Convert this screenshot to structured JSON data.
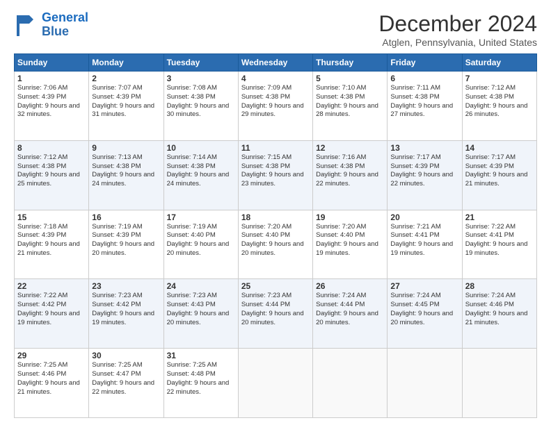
{
  "logo": {
    "line1": "General",
    "line2": "Blue"
  },
  "title": "December 2024",
  "location": "Atglen, Pennsylvania, United States",
  "days_of_week": [
    "Sunday",
    "Monday",
    "Tuesday",
    "Wednesday",
    "Thursday",
    "Friday",
    "Saturday"
  ],
  "weeks": [
    [
      {
        "day": "1",
        "sunrise": "Sunrise: 7:06 AM",
        "sunset": "Sunset: 4:39 PM",
        "daylight": "Daylight: 9 hours and 32 minutes."
      },
      {
        "day": "2",
        "sunrise": "Sunrise: 7:07 AM",
        "sunset": "Sunset: 4:39 PM",
        "daylight": "Daylight: 9 hours and 31 minutes."
      },
      {
        "day": "3",
        "sunrise": "Sunrise: 7:08 AM",
        "sunset": "Sunset: 4:38 PM",
        "daylight": "Daylight: 9 hours and 30 minutes."
      },
      {
        "day": "4",
        "sunrise": "Sunrise: 7:09 AM",
        "sunset": "Sunset: 4:38 PM",
        "daylight": "Daylight: 9 hours and 29 minutes."
      },
      {
        "day": "5",
        "sunrise": "Sunrise: 7:10 AM",
        "sunset": "Sunset: 4:38 PM",
        "daylight": "Daylight: 9 hours and 28 minutes."
      },
      {
        "day": "6",
        "sunrise": "Sunrise: 7:11 AM",
        "sunset": "Sunset: 4:38 PM",
        "daylight": "Daylight: 9 hours and 27 minutes."
      },
      {
        "day": "7",
        "sunrise": "Sunrise: 7:12 AM",
        "sunset": "Sunset: 4:38 PM",
        "daylight": "Daylight: 9 hours and 26 minutes."
      }
    ],
    [
      {
        "day": "8",
        "sunrise": "Sunrise: 7:12 AM",
        "sunset": "Sunset: 4:38 PM",
        "daylight": "Daylight: 9 hours and 25 minutes."
      },
      {
        "day": "9",
        "sunrise": "Sunrise: 7:13 AM",
        "sunset": "Sunset: 4:38 PM",
        "daylight": "Daylight: 9 hours and 24 minutes."
      },
      {
        "day": "10",
        "sunrise": "Sunrise: 7:14 AM",
        "sunset": "Sunset: 4:38 PM",
        "daylight": "Daylight: 9 hours and 24 minutes."
      },
      {
        "day": "11",
        "sunrise": "Sunrise: 7:15 AM",
        "sunset": "Sunset: 4:38 PM",
        "daylight": "Daylight: 9 hours and 23 minutes."
      },
      {
        "day": "12",
        "sunrise": "Sunrise: 7:16 AM",
        "sunset": "Sunset: 4:38 PM",
        "daylight": "Daylight: 9 hours and 22 minutes."
      },
      {
        "day": "13",
        "sunrise": "Sunrise: 7:17 AM",
        "sunset": "Sunset: 4:39 PM",
        "daylight": "Daylight: 9 hours and 22 minutes."
      },
      {
        "day": "14",
        "sunrise": "Sunrise: 7:17 AM",
        "sunset": "Sunset: 4:39 PM",
        "daylight": "Daylight: 9 hours and 21 minutes."
      }
    ],
    [
      {
        "day": "15",
        "sunrise": "Sunrise: 7:18 AM",
        "sunset": "Sunset: 4:39 PM",
        "daylight": "Daylight: 9 hours and 21 minutes."
      },
      {
        "day": "16",
        "sunrise": "Sunrise: 7:19 AM",
        "sunset": "Sunset: 4:39 PM",
        "daylight": "Daylight: 9 hours and 20 minutes."
      },
      {
        "day": "17",
        "sunrise": "Sunrise: 7:19 AM",
        "sunset": "Sunset: 4:40 PM",
        "daylight": "Daylight: 9 hours and 20 minutes."
      },
      {
        "day": "18",
        "sunrise": "Sunrise: 7:20 AM",
        "sunset": "Sunset: 4:40 PM",
        "daylight": "Daylight: 9 hours and 20 minutes."
      },
      {
        "day": "19",
        "sunrise": "Sunrise: 7:20 AM",
        "sunset": "Sunset: 4:40 PM",
        "daylight": "Daylight: 9 hours and 19 minutes."
      },
      {
        "day": "20",
        "sunrise": "Sunrise: 7:21 AM",
        "sunset": "Sunset: 4:41 PM",
        "daylight": "Daylight: 9 hours and 19 minutes."
      },
      {
        "day": "21",
        "sunrise": "Sunrise: 7:22 AM",
        "sunset": "Sunset: 4:41 PM",
        "daylight": "Daylight: 9 hours and 19 minutes."
      }
    ],
    [
      {
        "day": "22",
        "sunrise": "Sunrise: 7:22 AM",
        "sunset": "Sunset: 4:42 PM",
        "daylight": "Daylight: 9 hours and 19 minutes."
      },
      {
        "day": "23",
        "sunrise": "Sunrise: 7:23 AM",
        "sunset": "Sunset: 4:42 PM",
        "daylight": "Daylight: 9 hours and 19 minutes."
      },
      {
        "day": "24",
        "sunrise": "Sunrise: 7:23 AM",
        "sunset": "Sunset: 4:43 PM",
        "daylight": "Daylight: 9 hours and 20 minutes."
      },
      {
        "day": "25",
        "sunrise": "Sunrise: 7:23 AM",
        "sunset": "Sunset: 4:44 PM",
        "daylight": "Daylight: 9 hours and 20 minutes."
      },
      {
        "day": "26",
        "sunrise": "Sunrise: 7:24 AM",
        "sunset": "Sunset: 4:44 PM",
        "daylight": "Daylight: 9 hours and 20 minutes."
      },
      {
        "day": "27",
        "sunrise": "Sunrise: 7:24 AM",
        "sunset": "Sunset: 4:45 PM",
        "daylight": "Daylight: 9 hours and 20 minutes."
      },
      {
        "day": "28",
        "sunrise": "Sunrise: 7:24 AM",
        "sunset": "Sunset: 4:46 PM",
        "daylight": "Daylight: 9 hours and 21 minutes."
      }
    ],
    [
      {
        "day": "29",
        "sunrise": "Sunrise: 7:25 AM",
        "sunset": "Sunset: 4:46 PM",
        "daylight": "Daylight: 9 hours and 21 minutes."
      },
      {
        "day": "30",
        "sunrise": "Sunrise: 7:25 AM",
        "sunset": "Sunset: 4:47 PM",
        "daylight": "Daylight: 9 hours and 22 minutes."
      },
      {
        "day": "31",
        "sunrise": "Sunrise: 7:25 AM",
        "sunset": "Sunset: 4:48 PM",
        "daylight": "Daylight: 9 hours and 22 minutes."
      },
      null,
      null,
      null,
      null
    ]
  ]
}
